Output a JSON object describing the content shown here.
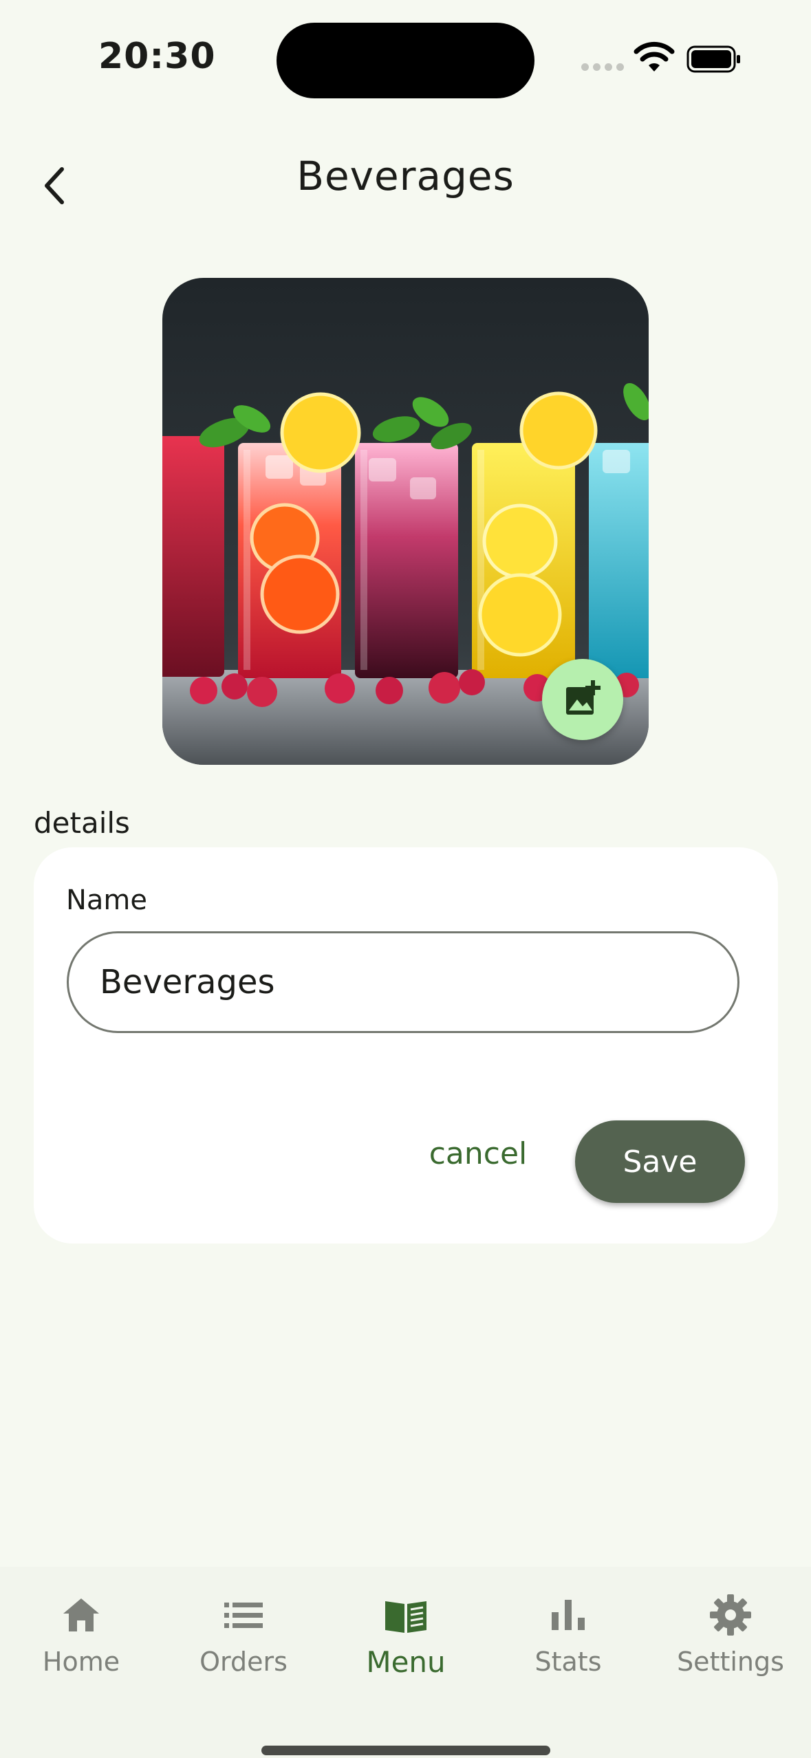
{
  "status_bar": {
    "time": "20:30"
  },
  "header": {
    "title": "Beverages",
    "back_icon": "chevron-left-icon"
  },
  "image": {
    "alt": "Colorful beverages in tall glasses",
    "add_photo_icon": "add-photo-icon"
  },
  "details": {
    "section_label": "details",
    "name_label": "Name",
    "name_value": "Beverages",
    "cancel_label": "cancel",
    "save_label": "Save"
  },
  "nav": {
    "items": [
      {
        "label": "Home",
        "icon": "home-icon",
        "active": false
      },
      {
        "label": "Orders",
        "icon": "list-icon",
        "active": false
      },
      {
        "label": "Menu",
        "icon": "book-icon",
        "active": true
      },
      {
        "label": "Stats",
        "icon": "bar-chart-icon",
        "active": false
      },
      {
        "label": "Settings",
        "icon": "gear-icon",
        "active": false
      }
    ]
  },
  "colors": {
    "background": "#f6f9f1",
    "accent": "#3a6a2f",
    "save_button": "#546350",
    "fab": "#b6efae"
  }
}
